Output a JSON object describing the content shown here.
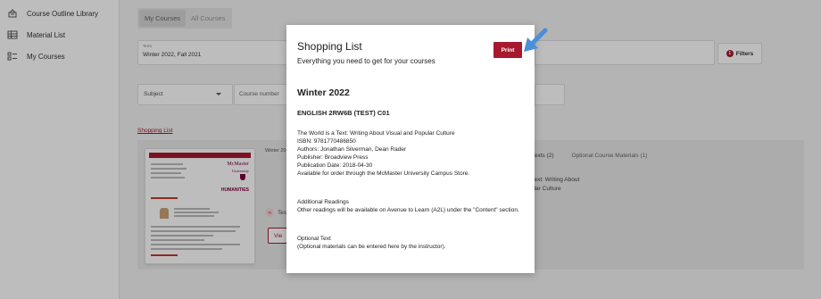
{
  "sidebar": {
    "items": [
      {
        "label": "Course Outline Library",
        "icon": "library-icon"
      },
      {
        "label": "Material List",
        "icon": "table-icon"
      },
      {
        "label": "My Courses",
        "icon": "list-icon"
      }
    ]
  },
  "main": {
    "tabs": [
      "My Courses",
      "All Courses"
    ],
    "term_label": "Term",
    "term_value": "Winter 2022, Fall 2021",
    "filters_label": "Filters",
    "filters_count": "1",
    "subject_label": "Subject",
    "course_number_placeholder": "Course number",
    "shopping_list_link": "Shopping List",
    "card": {
      "logo_line1": "McMaster",
      "logo_line2": "University",
      "department": "HUMANITIES"
    },
    "course_term_prefix": "Winter 20",
    "tag_initials": "TI",
    "tag_text": "Tes",
    "view_label": "Vie",
    "right_tabs": [
      "s and Texts (2)",
      "Optional Course Materials (1)"
    ],
    "right_text_lines": [
      "d is a Text: Writing About",
      "d Popular Culture"
    ],
    "right_text_other": "gs"
  },
  "modal": {
    "title": "Shopping List",
    "subtitle": "Everything you need to get for your courses",
    "print_label": "Print",
    "term": "Winter 2022",
    "course": "ENGLISH 2RW6B (TEST) C01",
    "book_lines": [
      "The World is a Text: Writing About Visual and Popular Culture",
      "ISBN: 9781770486850",
      "Authors: Jonathan Silverman, Dean Rader",
      "Publisher: Broadview Press",
      "Publication Date: 2018-04-30",
      "Available for order through the McMaster University Campus Store."
    ],
    "additional_title": "Additional Readings",
    "additional_text": "Other readings will be available on Avenue to Learn (A2L) under the \"Content\" section.",
    "optional_title": "Optional Text",
    "optional_text": "(Optional materials can be entered here by the instructor)."
  },
  "colors": {
    "accent": "#a6192e",
    "arrow": "#4a8fd8"
  }
}
